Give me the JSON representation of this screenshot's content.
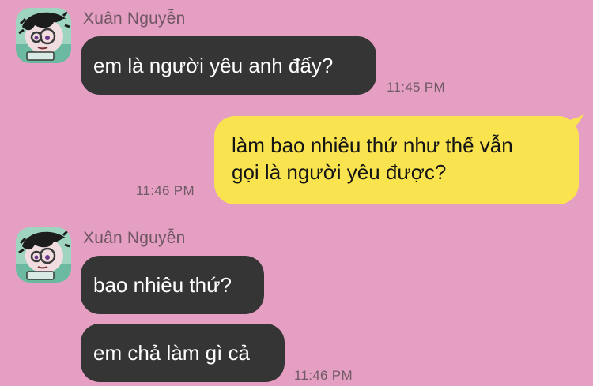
{
  "messages": [
    {
      "sender": "Xuân Nguyễn",
      "direction": "incoming",
      "bubbles": [
        "em là người yêu anh đấy?"
      ],
      "time": "11:45 PM"
    },
    {
      "direction": "outgoing",
      "lines": [
        "làm bao nhiêu thứ như thế vẫn",
        "gọi là người yêu được?"
      ],
      "time": "11:46 PM"
    },
    {
      "sender": "Xuân Nguyễn",
      "direction": "incoming",
      "bubbles": [
        "bao nhiêu thứ?",
        "em chả làm gì cả"
      ],
      "time": "11:46 PM"
    }
  ],
  "colors": {
    "background": "#e59fc2",
    "incoming_bubble": "#363536",
    "outgoing_bubble": "#f9e44f",
    "avatar_bg": "#9fd4c0"
  },
  "icons": {
    "avatar": "cartoon-avatar-icon"
  }
}
